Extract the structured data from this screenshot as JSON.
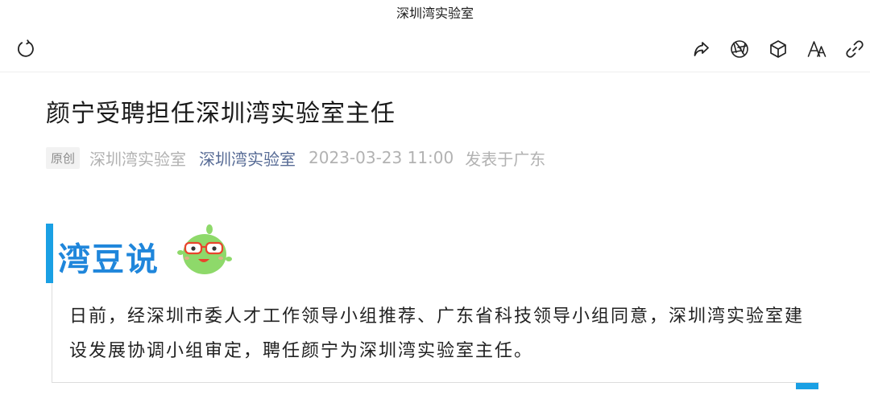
{
  "window": {
    "title": "深圳湾实验室"
  },
  "toolbar": {
    "left": [
      {
        "icon": "refresh-icon"
      }
    ],
    "right": [
      {
        "icon": "share-icon"
      },
      {
        "icon": "aperture-icon"
      },
      {
        "icon": "cube-icon"
      },
      {
        "icon": "font-size-icon"
      },
      {
        "icon": "link-icon"
      }
    ]
  },
  "article": {
    "title": "颜宁受聘担任深圳湾实验室主任",
    "meta": {
      "badge": "原创",
      "author": "深圳湾实验室",
      "account": "深圳湾实验室",
      "date": "2023-03-23 11:00",
      "location": "发表于广东"
    },
    "callout": {
      "brand": "湾豆说",
      "text": "日前，经深圳市委人才工作领导小组推荐、广东省科技领导小组同意，深圳湾实验室建设发展协调小组审定，聘任颜宁为深圳湾实验室主任。"
    }
  },
  "colors": {
    "accent_link": "#576b95",
    "callout_blue": "#1aa0e4",
    "brand_blue": "#1f86db",
    "mascot_green": "#8ed96a",
    "glasses_red": "#e8452c"
  }
}
